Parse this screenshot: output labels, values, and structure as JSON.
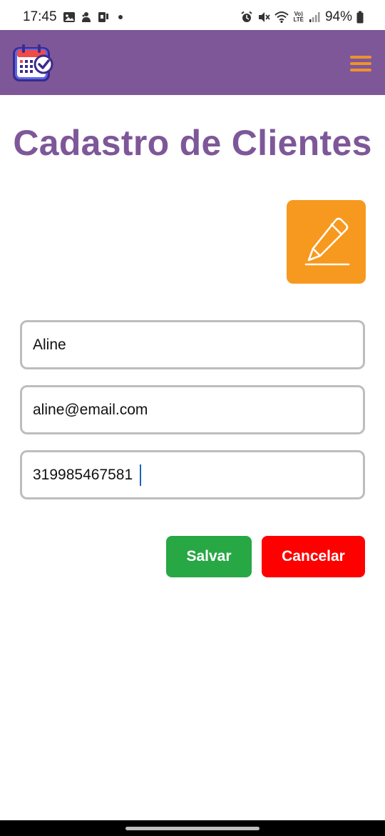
{
  "status_bar": {
    "time": "17:45",
    "left_icons": [
      "gallery-icon",
      "notification-icon",
      "sim-icon"
    ],
    "right_icons": [
      "alarm-icon",
      "mute-icon",
      "wifi-icon",
      "lte-icon",
      "signal-icon"
    ],
    "lte_text": "Vo)\nLTE",
    "battery": "94%"
  },
  "header": {
    "logo_icon": "calendar-check-icon",
    "menu_icon": "hamburger-menu-icon"
  },
  "main": {
    "title": "Cadastro de Clientes",
    "edit_icon": "pencil-icon"
  },
  "form": {
    "name": "Aline",
    "email": "aline@email.com",
    "phone": "319985467581"
  },
  "actions": {
    "save_label": "Salvar",
    "cancel_label": "Cancelar"
  },
  "colors": {
    "header_bg": "#7e5799",
    "title": "#7e5799",
    "menu": "#f0922b",
    "edit_bg": "#f7991e",
    "save_bg": "#28a745",
    "cancel_bg": "#ff0000"
  }
}
